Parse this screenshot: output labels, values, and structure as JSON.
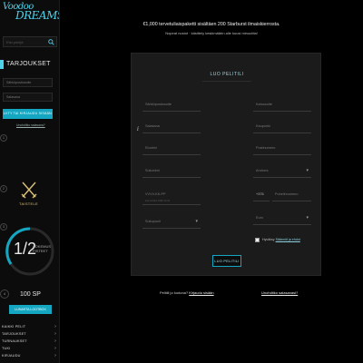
{
  "sidebar": {
    "logo": {
      "line1": "Voodoo",
      "line2": "DREAMS"
    },
    "search": {
      "placeholder": "Etsi pelejä"
    },
    "section_title": "TARJOUKSET",
    "login": {
      "email_placeholder": "Sähköpostiosoite",
      "password_placeholder": "Salasana",
      "button": "LIITY TAI KIRJAUDU SISÄÄN",
      "forgot": "Unohditko salasana?"
    },
    "stage_numbers": [
      "1",
      "2",
      "3"
    ],
    "fight_label": "TAISTELE",
    "level": {
      "fraction": "1/2",
      "xp_line1": "KOKEMUS",
      "xp_line2": "PISTEET"
    },
    "sp": {
      "value": "100 SP"
    },
    "collect_button": "LUNASTA LOOTBOX",
    "nav": [
      {
        "label": "KAIKKI PELIT"
      },
      {
        "label": "TARJOUKSET"
      },
      {
        "label": "TURNAUKSET"
      },
      {
        "label": "TUKI"
      },
      {
        "label": "KIRJAUDU"
      }
    ]
  },
  "main": {
    "promo_text": "€1,000 tervetuliaispaketti sisältäen 200 Starburst ilmaiskierrosta.",
    "promo_sub": "Nopeat nostot · käsittely keskimäärin alle kuusi minuuttia!",
    "form": {
      "title": "LUO PELITILI",
      "left_fields": [
        {
          "placeholder": "Sähköpostiosoite"
        },
        {
          "placeholder": "Salasana"
        },
        {
          "placeholder": "Etunimi"
        },
        {
          "placeholder": "Sukunimi"
        },
        {
          "placeholder": "VVVV-KK-PP",
          "sub": "Esimerkiksi 1980-10-26"
        },
        {
          "placeholder": "Sukupuoli"
        }
      ],
      "right_fields": [
        {
          "placeholder": "Katuosoite"
        },
        {
          "placeholder": "Kaupunki"
        },
        {
          "placeholder": "Postinumero"
        },
        {
          "placeholder": "Andorra"
        },
        {
          "prefix": "+376",
          "placeholder": "Puhelinnumero"
        },
        {
          "placeholder": "Euro"
        }
      ],
      "terms_prefix": "Hyväksy",
      "terms_link": "Säännöt ja ehdot",
      "submit": "LUO PELITILI"
    },
    "bottom": {
      "have_account": "Pelitili jo luotuna?",
      "login_link": "Kirjaudu sisään",
      "forgot_password": "Unohditko salasanasi?"
    }
  },
  "colors": {
    "accent": "#15a7c2",
    "logo": "#4fd1e8",
    "gold": "#d9c178",
    "panel": "#1b1b1b"
  }
}
